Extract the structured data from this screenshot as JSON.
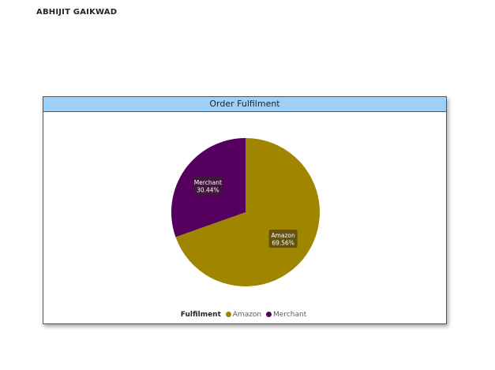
{
  "report": {
    "author": "ABHIJIT GAIKWAD"
  },
  "visual": {
    "title": "Order Fulfilment",
    "header_color": "#9fd0f7"
  },
  "chart_data": {
    "type": "pie",
    "title": "Order Fulfilment",
    "legend_title": "Fulfilment",
    "legend_position": "bottom-center",
    "slices": [
      {
        "name": "Amazon",
        "value": 69.56,
        "label": "69.56%",
        "color": "#a08600"
      },
      {
        "name": "Merchant",
        "value": 30.44,
        "label": "30.44%",
        "color": "#55005f"
      }
    ]
  }
}
